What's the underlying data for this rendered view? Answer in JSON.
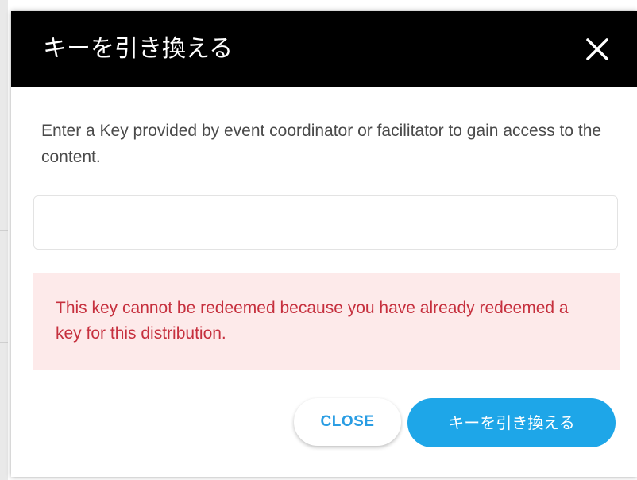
{
  "dialog": {
    "title": "キーを引き換える",
    "close_icon": "close-icon",
    "description": "Enter a Key provided by event coordinator or facilitator to gain access to the content.",
    "key_input": {
      "value": "",
      "placeholder": ""
    },
    "error_message": "This key cannot be redeemed because you have already redeemed a key for this distribution.",
    "buttons": {
      "close_label": "CLOSE",
      "redeem_label": "キーを引き換える"
    }
  },
  "colors": {
    "header_background": "#000000",
    "error_background": "#fdeaea",
    "error_text": "#c6303e",
    "accent": "#1ea6e8"
  }
}
